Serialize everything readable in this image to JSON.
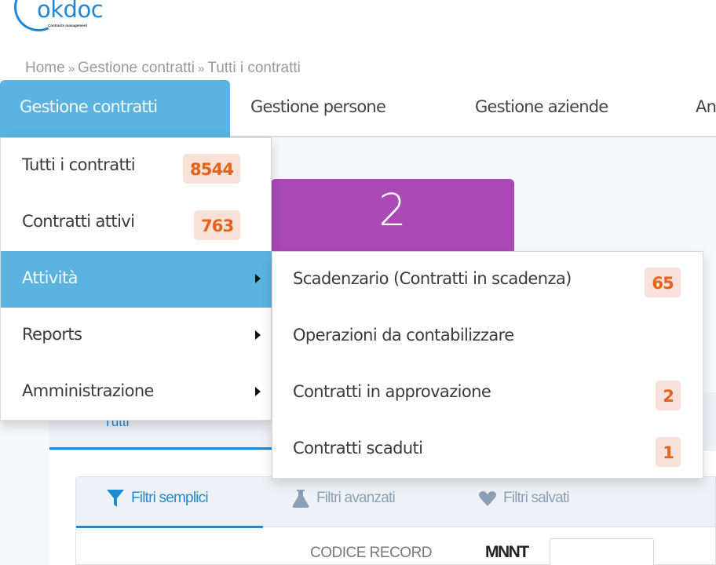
{
  "brand": {
    "name": "okdoc",
    "tagline": "Contracts management",
    "color": "#1e88d8"
  },
  "breadcrumb": {
    "items": [
      "Home",
      "Gestione contratti",
      "Tutti i contratti"
    ],
    "separator": "»"
  },
  "topnav": {
    "tabs": [
      {
        "label": "Gestione contratti",
        "active": true
      },
      {
        "label": "Gestione persone",
        "active": false
      },
      {
        "label": "Gestione aziende",
        "active": false
      },
      {
        "label": "An",
        "active": false
      }
    ],
    "accent": "#5bb3df"
  },
  "menu": {
    "items": [
      {
        "label": "Tutti i contratti",
        "badge": "8544",
        "has_submenu": false
      },
      {
        "label": "Contratti attivi",
        "badge": "763",
        "has_submenu": false
      },
      {
        "label": "Attività",
        "badge": null,
        "has_submenu": true,
        "active": true
      },
      {
        "label": "Reports",
        "badge": null,
        "has_submenu": true
      },
      {
        "label": "Amministrazione",
        "badge": null,
        "has_submenu": true
      }
    ]
  },
  "submenu": {
    "items": [
      {
        "label": "Scadenzario (Contratti in scadenza)",
        "badge": "65"
      },
      {
        "label": "Operazioni da contabilizzare",
        "badge": null
      },
      {
        "label": "Contratti in approvazione",
        "badge": "2"
      },
      {
        "label": "Contratti scaduti",
        "badge": "1"
      }
    ]
  },
  "summary_card": {
    "value": "2",
    "color": "#ab4ab6"
  },
  "panel": {
    "tab_label": "Tutti"
  },
  "filters": {
    "tabs": [
      {
        "label": "Filtri semplici",
        "icon": "funnel-icon",
        "active": true
      },
      {
        "label": "Filtri avanzati",
        "icon": "flask-icon",
        "active": false
      },
      {
        "label": "Filtri salvati",
        "icon": "heart-icon",
        "active": false
      }
    ],
    "field": {
      "label": "CODICE RECORD",
      "prefix": "MNNT",
      "value": ""
    }
  },
  "badge_colors": {
    "background": "#f8e1d8",
    "text": "#e5621b"
  }
}
